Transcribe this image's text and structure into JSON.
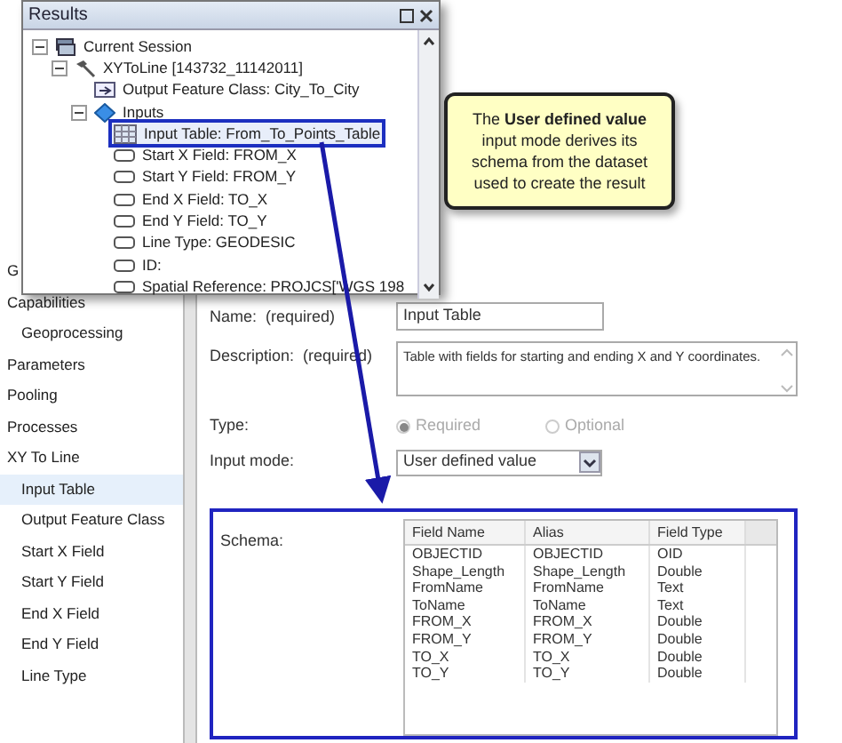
{
  "sidebar": {
    "items": [
      {
        "label": "G",
        "selected": false
      },
      {
        "label": "Capabilities",
        "selected": false,
        "children": [
          {
            "label": "Geoprocessing",
            "selected": false
          }
        ]
      },
      {
        "label": "Parameters",
        "selected": false
      },
      {
        "label": "Pooling",
        "selected": false
      },
      {
        "label": "Processes",
        "selected": false
      },
      {
        "label": "XY To Line",
        "selected": false,
        "children": [
          {
            "label": "Input Table",
            "selected": true
          },
          {
            "label": "Output Feature Class",
            "selected": false
          },
          {
            "label": "Start X Field",
            "selected": false
          },
          {
            "label": "Start Y Field",
            "selected": false
          },
          {
            "label": "End X Field",
            "selected": false
          },
          {
            "label": "End Y Field",
            "selected": false
          },
          {
            "label": "Line Type",
            "selected": false
          }
        ]
      }
    ]
  },
  "form": {
    "name": {
      "label": "Name:  (required)",
      "value": "Input Table"
    },
    "description": {
      "label": "Description:  (required)",
      "value": "Table with fields for starting and ending X and Y coordinates."
    },
    "type": {
      "label": "Type:",
      "disabled": true,
      "options": [
        {
          "label": "Required",
          "selected": true
        },
        {
          "label": "Optional",
          "selected": false
        }
      ]
    },
    "input_mode": {
      "label": "Input mode:",
      "value": "User defined value"
    },
    "schema": {
      "label": "Schema:",
      "columns": [
        "Field Name",
        "Alias",
        "Field Type"
      ],
      "rows": [
        [
          "OBJECTID",
          "OBJECTID",
          "OID"
        ],
        [
          "Shape_Length",
          "Shape_Length",
          "Double"
        ],
        [
          "FromName",
          "FromName",
          "Text"
        ],
        [
          "ToName",
          "ToName",
          "Text"
        ],
        [
          "FROM_X",
          "FROM_X",
          "Double"
        ],
        [
          "FROM_Y",
          "FROM_Y",
          "Double"
        ],
        [
          "TO_X",
          "TO_X",
          "Double"
        ],
        [
          "TO_Y",
          "TO_Y",
          "Double"
        ]
      ]
    }
  },
  "results": {
    "title": "Results",
    "tree": [
      {
        "kind": "session",
        "label": "Current Session",
        "expanded": true,
        "selected": false,
        "children": [
          {
            "kind": "tool",
            "label": "XYToLine [143732_11142011]",
            "expanded": true,
            "selected": false,
            "children": [
              {
                "kind": "output",
                "label": "Output Feature Class: City_To_City",
                "selected": false
              },
              {
                "kind": "inputs",
                "label": "Inputs",
                "expanded": true,
                "selected": false,
                "children": [
                  {
                    "kind": "table",
                    "label": "Input Table: From_To_Points_Table",
                    "selected": true
                  },
                  {
                    "kind": "field",
                    "label": "Start X Field: FROM_X",
                    "selected": false
                  },
                  {
                    "kind": "field",
                    "label": "Start Y Field: FROM_Y",
                    "selected": false
                  },
                  {
                    "kind": "field",
                    "label": "End X Field: TO_X",
                    "selected": false
                  },
                  {
                    "kind": "field",
                    "label": "End Y Field: TO_Y",
                    "selected": false
                  },
                  {
                    "kind": "field",
                    "label": "Line Type: GEODESIC",
                    "selected": false
                  },
                  {
                    "kind": "field",
                    "label": "ID:",
                    "selected": false
                  },
                  {
                    "kind": "field",
                    "label": "Spatial Reference: PROJCS['WGS 198",
                    "selected": false
                  }
                ]
              }
            ]
          }
        ]
      }
    ]
  },
  "callout": {
    "text": "The **User defined value** input mode derives its schema from the dataset used to create the result"
  }
}
